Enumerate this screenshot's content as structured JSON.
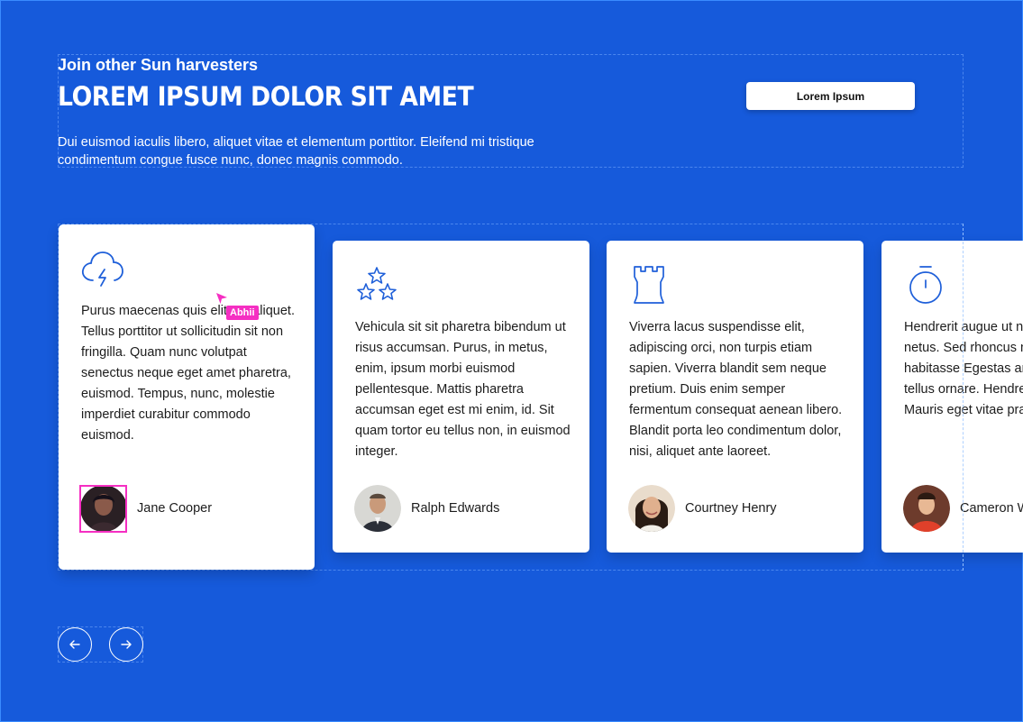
{
  "header": {
    "eyebrow": "Join other Sun harvesters",
    "title": "LOREM IPSUM DOLOR SIT AMET",
    "description": "Dui euismod iaculis libero, aliquet vitae et elementum porttitor. Eleifend mi tristique condimentum congue fusce nunc, donec magnis commodo.",
    "cta_label": "Lorem Ipsum"
  },
  "cards": [
    {
      "icon": "cloud-lightning-icon",
      "text": "Purus maecenas quis elit eu, aliquet. Tellus porttitor ut sollicitudin sit non fringilla. Quam nunc volutpat senectus neque eget amet pharetra, euismod. Tempus, nunc, molestie imperdiet curabitur commodo euismod.",
      "name": "Jane Cooper"
    },
    {
      "icon": "stars-icon",
      "text": "Vehicula sit sit pharetra bibendum ut risus accumsan. Purus, in metus, enim, ipsum morbi euismod pellentesque. Mattis pharetra accumsan eget est mi enim, id. Sit quam tortor eu tellus non, in euismod integer.",
      "name": "Ralph Edwards"
    },
    {
      "icon": "chess-rook-icon",
      "text": "Viverra lacus suspendisse elit, adipiscing orci, non turpis etiam sapien. Viverra blandit sem neque pretium. Duis enim semper fermentum consequat aenean libero. Blandit porta leo condimentum dolor, nisi, aliquet ante laoreet.",
      "name": "Courtney Henry"
    },
    {
      "icon": "stopwatch-icon",
      "text": "Hendrerit augue ut nec quis integer netus. Sed rhoncus magnis habitasse Egestas amet habitant tellus ornare. Hendrerit senectus. Mauris eget vitae praesent neque.",
      "name": "Cameron Williamson"
    }
  ],
  "navigation": {
    "prev_icon": "arrow-left-icon",
    "next_icon": "arrow-right-icon"
  },
  "cursor": {
    "label": "Abhii"
  },
  "colors": {
    "background": "#165ADB",
    "accent": "#1E5FD9",
    "selection": "#F52FC2",
    "card": "#FFFFFF"
  }
}
